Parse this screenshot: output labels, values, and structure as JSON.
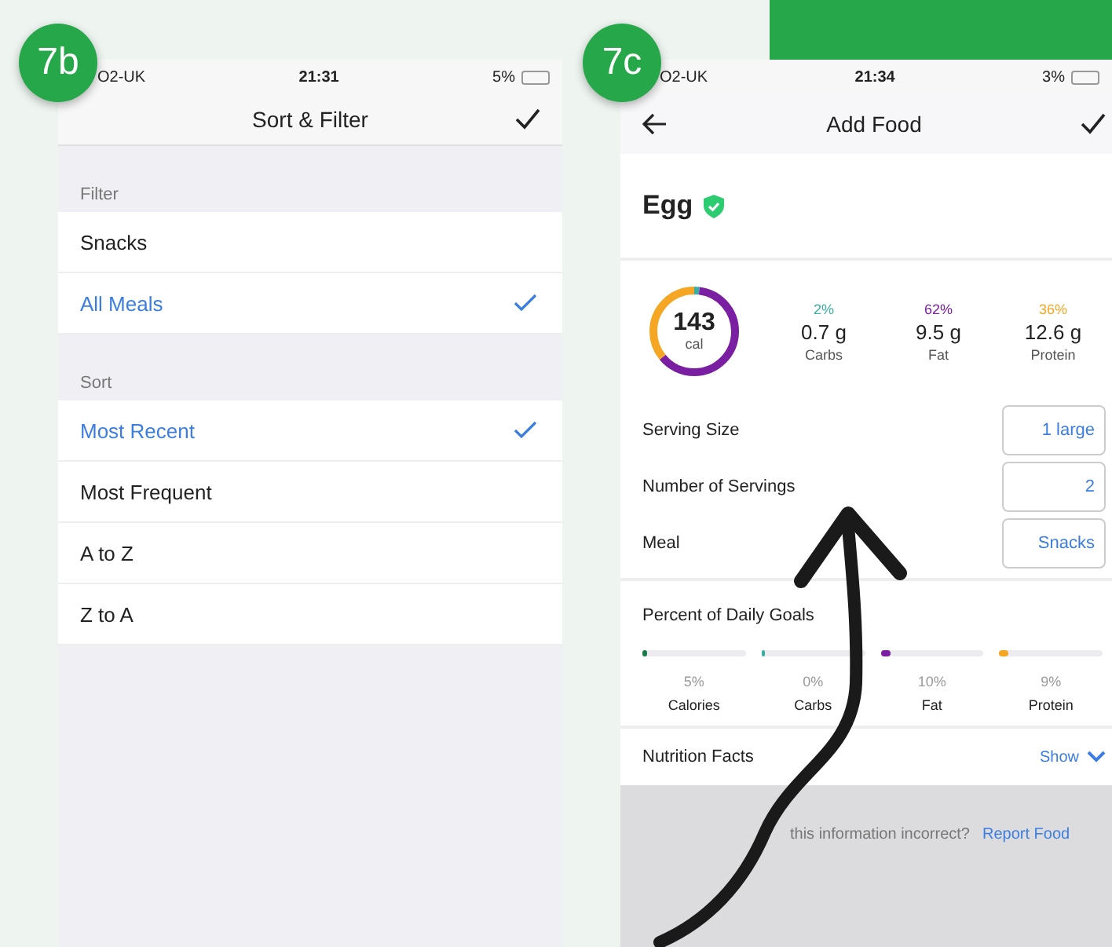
{
  "panels": [
    {
      "badge": "7b",
      "status_bar": {
        "carrier": "O2-UK",
        "time": "21:31",
        "battery": "5%"
      },
      "nav": {
        "title": "Sort & Filter"
      },
      "sections": [
        {
          "header": "Filter",
          "items": [
            {
              "label": "Snacks",
              "selected": false
            },
            {
              "label": "All Meals",
              "selected": true
            }
          ]
        },
        {
          "header": "Sort",
          "items": [
            {
              "label": "Most Recent",
              "selected": true
            },
            {
              "label": "Most Frequent",
              "selected": false
            },
            {
              "label": "A to Z",
              "selected": false
            },
            {
              "label": "Z to A",
              "selected": false
            }
          ]
        }
      ]
    },
    {
      "badge": "7c",
      "status_bar": {
        "carrier": "O2-UK",
        "time": "21:34",
        "battery": "3%"
      },
      "nav": {
        "title": "Add Food"
      },
      "food": {
        "name": "Egg",
        "verified": true
      },
      "calories": {
        "value": "143",
        "unit": "cal"
      },
      "macros": [
        {
          "percent": "2%",
          "amount": "0.7 g",
          "label": "Carbs",
          "color": "#3aaea0",
          "level": 0.02
        },
        {
          "percent": "62%",
          "amount": "9.5 g",
          "label": "Fat",
          "color": "#7b1fa2",
          "level": 0.62
        },
        {
          "percent": "36%",
          "amount": "12.6 g",
          "label": "Protein",
          "color": "#f5a623",
          "level": 0.36
        }
      ],
      "fields": [
        {
          "label": "Serving Size",
          "value": "1 large"
        },
        {
          "label": "Number of Servings",
          "value": "2"
        },
        {
          "label": "Meal",
          "value": "Snacks"
        }
      ],
      "goals": {
        "title": "Percent of Daily Goals",
        "items": [
          {
            "percent": "5%",
            "label": "Calories",
            "color": "#1e7a4a",
            "level": 0.05
          },
          {
            "percent": "0%",
            "label": "Carbs",
            "color": "#3aaea0",
            "level": 0.0
          },
          {
            "percent": "10%",
            "label": "Fat",
            "color": "#7b1fa2",
            "level": 0.1
          },
          {
            "percent": "9%",
            "label": "Protein",
            "color": "#f5a623",
            "level": 0.09
          }
        ]
      },
      "nutrition_facts": {
        "title": "Nutrition Facts",
        "action": "Show"
      },
      "footer": {
        "question": "this information incorrect?",
        "link": "Report Food"
      }
    }
  ]
}
